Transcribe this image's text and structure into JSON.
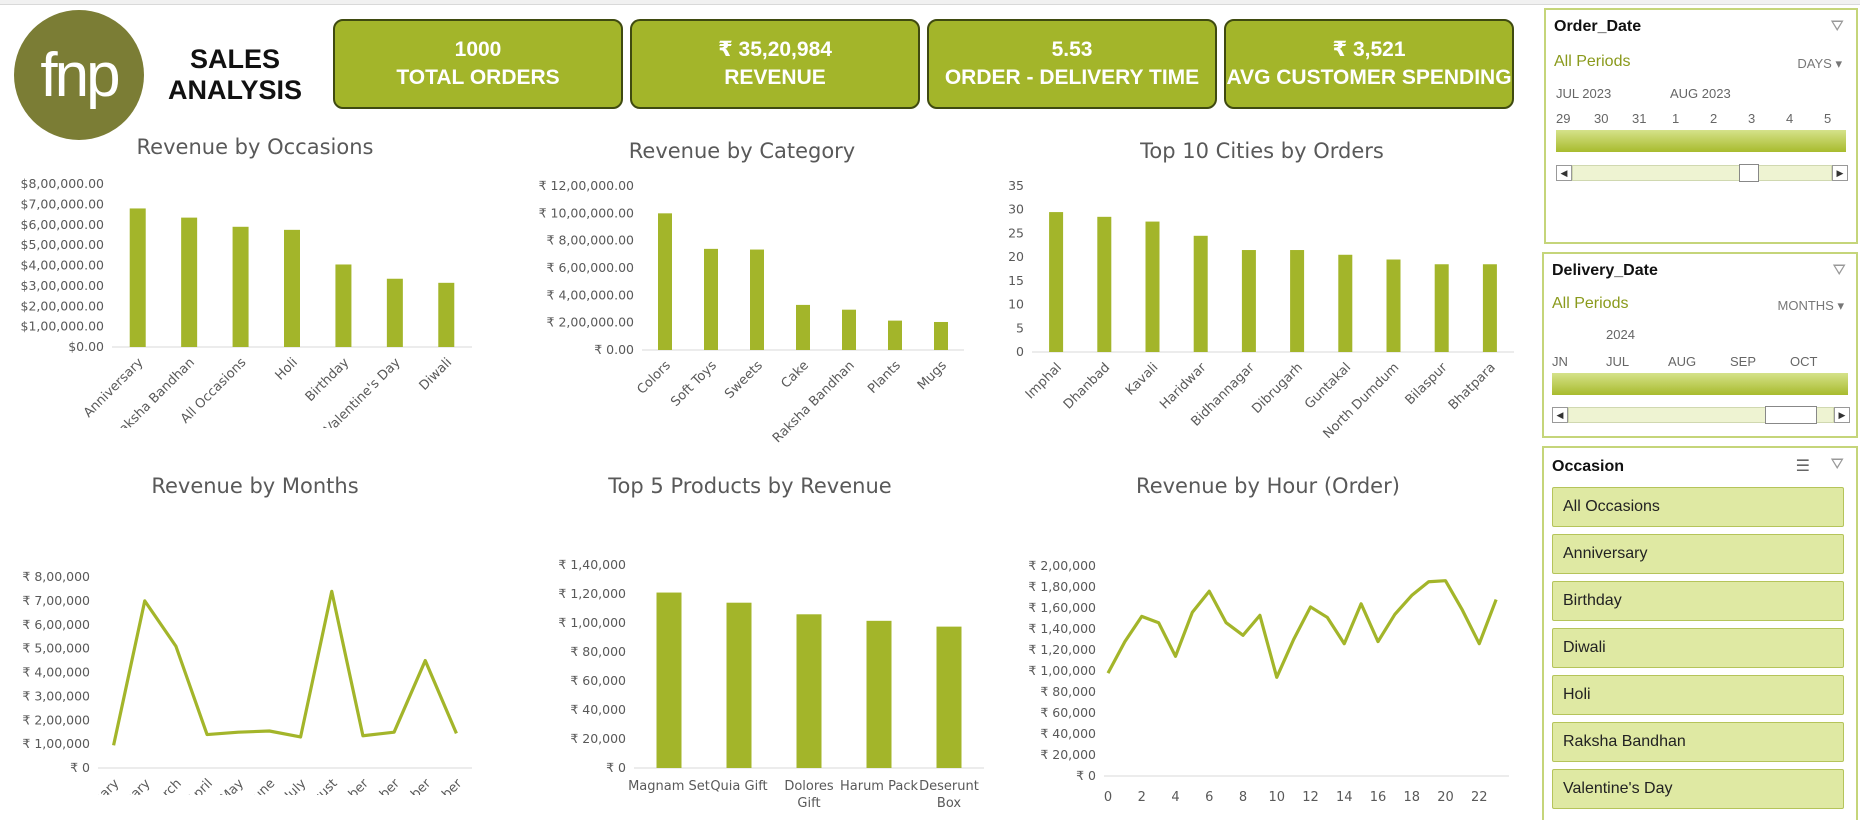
{
  "brand": {
    "logo_text": "fnp",
    "title_line1": "SALES",
    "title_line2": "ANALYSIS"
  },
  "kpis": [
    {
      "value": "1000",
      "label": "TOTAL ORDERS"
    },
    {
      "value": "₹ 35,20,984",
      "label": "REVENUE"
    },
    {
      "value": "5.53",
      "label": "ORDER - DELIVERY TIME"
    },
    {
      "value": "₹ 3,521",
      "label": "AVG CUSTOMER SPENDING"
    }
  ],
  "colors": {
    "accent": "#a3b52a",
    "accent_dark": "#3f4a10",
    "logo": "#7b7d35",
    "slicer_item": "#dfe9a3"
  },
  "chart_data": [
    {
      "id": "occasions",
      "type": "bar",
      "title": "Revenue by Occasions",
      "categories": [
        "Anniversary",
        "Raksha Bandhan",
        "All Occasions",
        "Holi",
        "Birthday",
        "Valentine's Day",
        "Diwali"
      ],
      "values": [
        680000,
        635000,
        590000,
        575000,
        405000,
        335000,
        315000
      ],
      "ylim": [
        0,
        800000
      ],
      "yticks": [
        "$0.00",
        "$1,00,000.00",
        "$2,00,000.00",
        "$3,00,000.00",
        "$4,00,000.00",
        "$5,00,000.00",
        "$6,00,000.00",
        "$7,00,000.00",
        "$8,00,000.00"
      ]
    },
    {
      "id": "category",
      "type": "bar",
      "title": "Revenue by Category",
      "categories": [
        "Colors",
        "Soft Toys",
        "Sweets",
        "Cake",
        "Raksha Bandhan",
        "Plants",
        "Mugs"
      ],
      "values": [
        1000000,
        740000,
        735000,
        330000,
        295000,
        215000,
        205000
      ],
      "ylim": [
        0,
        1200000
      ],
      "yticks": [
        "₹ 0.00",
        "₹ 2,00,000.00",
        "₹ 4,00,000.00",
        "₹ 6,00,000.00",
        "₹ 8,00,000.00",
        "₹ 10,00,000.00",
        "₹ 12,00,000.00"
      ]
    },
    {
      "id": "cities",
      "type": "bar",
      "title": "Top 10 Cities by Orders",
      "categories": [
        "Imphal",
        "Dhanbad",
        "Kavali",
        "Haridwar",
        "Bidhannagar",
        "Dibrugarh",
        "Guntakal",
        "North Dumdum",
        "Bilaspur",
        "Bhatpara"
      ],
      "values": [
        29.5,
        28.5,
        27.5,
        24.5,
        21.5,
        21.5,
        20.5,
        19.5,
        18.5,
        18.5
      ],
      "ylim": [
        0,
        35
      ],
      "yticks": [
        "0",
        "5",
        "10",
        "15",
        "20",
        "25",
        "30",
        "35"
      ]
    },
    {
      "id": "months",
      "type": "line",
      "title": "Revenue by Months",
      "categories": [
        "January",
        "February",
        "March",
        "April",
        "May",
        "June",
        "July",
        "August",
        "September",
        "October",
        "November",
        "December"
      ],
      "values": [
        95000,
        700000,
        510000,
        140000,
        150000,
        155000,
        130000,
        740000,
        135000,
        150000,
        450000,
        145000
      ],
      "ylim": [
        0,
        800000
      ],
      "yticks": [
        "₹ 0",
        "₹ 1,00,000",
        "₹ 2,00,000",
        "₹ 3,00,000",
        "₹ 4,00,000",
        "₹ 5,00,000",
        "₹ 6,00,000",
        "₹ 7,00,000",
        "₹ 8,00,000"
      ]
    },
    {
      "id": "products",
      "type": "bar",
      "title": "Top 5 Products by Revenue",
      "categories": [
        "Magnam Set",
        "Quia Gift",
        "Dolores Gift",
        "Harum Pack",
        "Deserunt Box"
      ],
      "values": [
        121000,
        114000,
        106000,
        101500,
        97500
      ],
      "ylim": [
        0,
        140000
      ],
      "yticks": [
        "₹ 0",
        "₹ 20,000",
        "₹ 40,000",
        "₹ 60,000",
        "₹ 80,000",
        "₹ 1,00,000",
        "₹ 1,20,000",
        "₹ 1,40,000"
      ]
    },
    {
      "id": "hours",
      "type": "line",
      "title": "Revenue by Hour (Order)",
      "x": [
        0,
        1,
        2,
        3,
        4,
        5,
        6,
        7,
        8,
        9,
        10,
        11,
        12,
        13,
        14,
        15,
        16,
        17,
        18,
        19,
        20,
        21,
        22,
        23
      ],
      "values": [
        98000,
        128000,
        152000,
        146000,
        114000,
        156000,
        176000,
        146000,
        134000,
        153000,
        94000,
        130000,
        161000,
        151000,
        126000,
        164000,
        128000,
        154000,
        172000,
        185000,
        186000,
        158000,
        126000,
        168000
      ],
      "ylim": [
        0,
        200000
      ],
      "xticks": [
        "0",
        "2",
        "4",
        "6",
        "8",
        "10",
        "12",
        "14",
        "16",
        "18",
        "20",
        "22"
      ],
      "yticks": [
        "₹ 0",
        "₹ 20,000",
        "₹ 40,000",
        "₹ 60,000",
        "₹ 80,000",
        "₹ 1,00,000",
        "₹ 1,20,000",
        "₹ 1,40,000",
        "₹ 1,60,000",
        "₹ 1,80,000",
        "₹ 2,00,000"
      ]
    }
  ],
  "slicers": {
    "order_date": {
      "title": "Order_Date",
      "all_periods": "All Periods",
      "unit": "DAYS",
      "month1": "JUL 2023",
      "month2": "AUG 2023",
      "days": [
        "29",
        "30",
        "31",
        "1",
        "2",
        "3",
        "4",
        "5"
      ]
    },
    "delivery_date": {
      "title": "Delivery_Date",
      "all_periods": "All Periods",
      "unit": "MONTHS",
      "year": "2024",
      "months": [
        "JN",
        "JUL",
        "AUG",
        "SEP",
        "OCT"
      ]
    },
    "occasion": {
      "title": "Occasion",
      "items": [
        "All Occasions",
        "Anniversary",
        "Birthday",
        "Diwali",
        "Holi",
        "Raksha Bandhan",
        "Valentine's Day"
      ]
    }
  }
}
